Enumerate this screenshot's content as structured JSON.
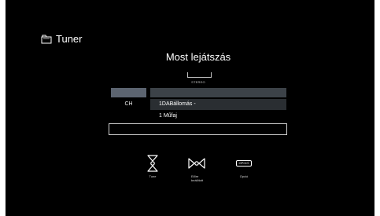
{
  "source": {
    "icon": "folder-tab-icon",
    "label": "Tuner"
  },
  "now_playing": {
    "title": "Most lejátszás",
    "mode": "STEREO"
  },
  "info": {
    "channel_label": "CH",
    "station": "1DABállomás -",
    "genre": "1 Műfaj"
  },
  "actions": {
    "tune": {
      "icon": "tune-arrows-icon",
      "label": "Tune"
    },
    "presets": {
      "icon": "preset-navigation-icon",
      "label": "Előre beállított"
    },
    "option": {
      "icon": "option-button-icon",
      "icon_text": "OPCIÓ",
      "label": "Opció"
    }
  },
  "colors": {
    "background": "#000000",
    "text": "#ffffff",
    "highlight_bar": "#5c6470",
    "row_bar": "#3c4248"
  }
}
